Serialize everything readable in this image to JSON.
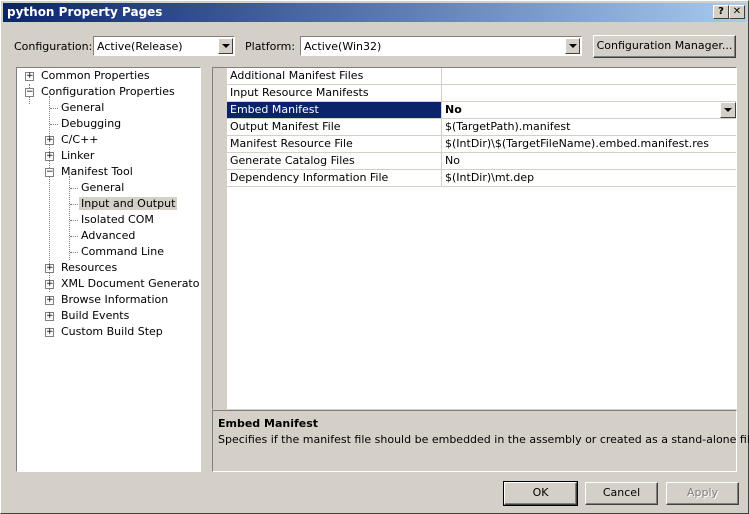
{
  "window": {
    "title": "python Property Pages",
    "help_button": "?",
    "close_button": "✕"
  },
  "toolbar": {
    "configuration_label": "Configuration:",
    "configuration_value": "Active(Release)",
    "platform_label": "Platform:",
    "platform_value": "Active(Win32)",
    "config_manager_label": "Configuration Manager..."
  },
  "tree": {
    "items": [
      {
        "label": "Common Properties",
        "expander": "+"
      },
      {
        "label": "Configuration Properties",
        "expander": "−"
      },
      {
        "label": "General"
      },
      {
        "label": "Debugging"
      },
      {
        "label": "C/C++",
        "expander": "+"
      },
      {
        "label": "Linker",
        "expander": "+"
      },
      {
        "label": "Manifest Tool",
        "expander": "−"
      },
      {
        "label": "General"
      },
      {
        "label": "Input and Output"
      },
      {
        "label": "Isolated COM"
      },
      {
        "label": "Advanced"
      },
      {
        "label": "Command Line"
      },
      {
        "label": "Resources",
        "expander": "+"
      },
      {
        "label": "XML Document Generator",
        "expander": "+"
      },
      {
        "label": "Browse Information",
        "expander": "+"
      },
      {
        "label": "Build Events",
        "expander": "+"
      },
      {
        "label": "Custom Build Step",
        "expander": "+"
      }
    ]
  },
  "properties": {
    "rows": [
      {
        "name": "Additional Manifest Files",
        "value": ""
      },
      {
        "name": "Input Resource Manifests",
        "value": ""
      },
      {
        "name": "Embed Manifest",
        "value": "No"
      },
      {
        "name": "Output Manifest File",
        "value": "$(TargetPath).manifest"
      },
      {
        "name": "Manifest Resource File",
        "value": "$(IntDir)\\$(TargetFileName).embed.manifest.res"
      },
      {
        "name": "Generate Catalog Files",
        "value": "No"
      },
      {
        "name": "Dependency Information File",
        "value": "$(IntDir)\\mt.dep"
      }
    ]
  },
  "description": {
    "title": "Embed Manifest",
    "text": "Specifies if the manifest file should be embedded in the assembly or created as a stand-alone file."
  },
  "buttons": {
    "ok": "OK",
    "cancel": "Cancel",
    "apply": "Apply"
  },
  "colors": {
    "selection": "#0a246a",
    "face": "#d4d0c8"
  }
}
